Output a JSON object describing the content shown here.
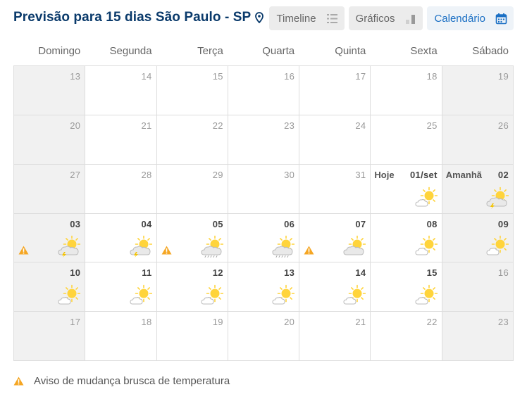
{
  "header": {
    "title": "Previsão para 15 dias São Paulo - SP",
    "location_icon": "map-pin-icon"
  },
  "view_buttons": [
    {
      "label": "Timeline",
      "icon": "list-icon",
      "active": false
    },
    {
      "label": "Gráficos",
      "icon": "bar-chart-icon",
      "active": false
    },
    {
      "label": "Calendário",
      "icon": "calendar-icon",
      "active": true
    }
  ],
  "weekdays": [
    "Domingo",
    "Segunda",
    "Terça",
    "Quarta",
    "Quinta",
    "Sexta",
    "Sábado"
  ],
  "weeks": [
    [
      {
        "day": "13"
      },
      {
        "day": "14"
      },
      {
        "day": "15"
      },
      {
        "day": "16"
      },
      {
        "day": "17"
      },
      {
        "day": "18"
      },
      {
        "day": "19"
      }
    ],
    [
      {
        "day": "20"
      },
      {
        "day": "21"
      },
      {
        "day": "22"
      },
      {
        "day": "23"
      },
      {
        "day": "24"
      },
      {
        "day": "25"
      },
      {
        "day": "26"
      }
    ],
    [
      {
        "day": "27"
      },
      {
        "day": "28"
      },
      {
        "day": "29"
      },
      {
        "day": "30"
      },
      {
        "day": "31"
      },
      {
        "day": "01/set",
        "label": "Hoje",
        "active": true,
        "icon": "sun-cloud"
      },
      {
        "day": "02",
        "label": "Amanhã",
        "active": true,
        "icon": "sun-storm-cloud"
      }
    ],
    [
      {
        "day": "03",
        "active": true,
        "icon": "sun-storm-cloud",
        "warning": true
      },
      {
        "day": "04",
        "active": true,
        "icon": "sun-storm-cloud"
      },
      {
        "day": "05",
        "active": true,
        "icon": "sun-rain-cloud",
        "warning": true
      },
      {
        "day": "06",
        "active": true,
        "icon": "sun-rain-cloud"
      },
      {
        "day": "07",
        "active": true,
        "icon": "sun-big-cloud",
        "warning": true
      },
      {
        "day": "08",
        "active": true,
        "icon": "sun-cloud"
      },
      {
        "day": "09",
        "active": true,
        "icon": "sun-cloud"
      }
    ],
    [
      {
        "day": "10",
        "active": true,
        "icon": "sun-cloud"
      },
      {
        "day": "11",
        "active": true,
        "icon": "sun-cloud"
      },
      {
        "day": "12",
        "active": true,
        "icon": "sun-cloud"
      },
      {
        "day": "13",
        "active": true,
        "icon": "sun-cloud"
      },
      {
        "day": "14",
        "active": true,
        "icon": "sun-cloud"
      },
      {
        "day": "15",
        "active": true,
        "icon": "sun-cloud"
      },
      {
        "day": "16"
      }
    ],
    [
      {
        "day": "17"
      },
      {
        "day": "18"
      },
      {
        "day": "19"
      },
      {
        "day": "20"
      },
      {
        "day": "21"
      },
      {
        "day": "22"
      },
      {
        "day": "23"
      }
    ]
  ],
  "legend": {
    "icon": "warning-icon",
    "text": "Aviso de mudança brusca de temperatura"
  },
  "colors": {
    "title": "#0a3a6b",
    "accent": "#1a6fc4",
    "warning": "#f5a623",
    "sun": "#ffd43b",
    "weekend_bg": "#f1f1f1"
  }
}
